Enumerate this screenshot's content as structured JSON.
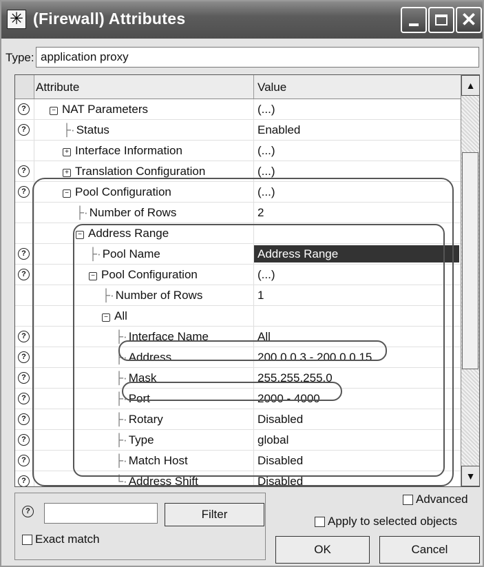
{
  "window": {
    "title": "(Firewall) Attributes",
    "title_icon": "star-icon",
    "controls": [
      "minimize-icon",
      "maximize-icon",
      "close-icon"
    ]
  },
  "type_field": {
    "label": "Type:",
    "value": "application proxy"
  },
  "grid": {
    "columns": {
      "attribute": "Attribute",
      "value": "Value"
    },
    "rows": [
      {
        "help": true,
        "indent": 1,
        "toggle": "minus",
        "name": "NAT Parameters",
        "value": "(...)"
      },
      {
        "help": true,
        "indent": 2,
        "toggle": "leaf",
        "name": "Status",
        "value": "Enabled"
      },
      {
        "help": false,
        "indent": 2,
        "toggle": "plus",
        "name": "Interface Information",
        "value": "(...)"
      },
      {
        "help": true,
        "indent": 2,
        "toggle": "plus",
        "name": "Translation Configuration",
        "value": "(...)"
      },
      {
        "help": true,
        "indent": 2,
        "toggle": "minus",
        "name": "Pool Configuration",
        "value": "(...)"
      },
      {
        "help": false,
        "indent": 3,
        "toggle": "leaf",
        "name": "Number of Rows",
        "value": "2"
      },
      {
        "help": false,
        "indent": 3,
        "toggle": "minus",
        "name": "Address Range",
        "value": ""
      },
      {
        "help": true,
        "indent": 4,
        "toggle": "leaf",
        "name": "Pool Name",
        "value": "Address Range",
        "selected": true
      },
      {
        "help": true,
        "indent": 4,
        "toggle": "minus",
        "name": "Pool Configuration",
        "value": "(...)"
      },
      {
        "help": false,
        "indent": 5,
        "toggle": "leaf",
        "name": "Number of Rows",
        "value": "1"
      },
      {
        "help": false,
        "indent": 5,
        "toggle": "minus",
        "name": "All",
        "value": ""
      },
      {
        "help": true,
        "indent": 6,
        "toggle": "leaf",
        "name": "Interface Name",
        "value": "All"
      },
      {
        "help": true,
        "indent": 6,
        "toggle": "leaf",
        "name": "Address",
        "value": "200.0.0.3 - 200.0.0.15"
      },
      {
        "help": true,
        "indent": 6,
        "toggle": "leaf",
        "name": "Mask",
        "value": "255.255.255.0"
      },
      {
        "help": true,
        "indent": 6,
        "toggle": "leaf",
        "name": "Port",
        "value": "2000 - 4000"
      },
      {
        "help": true,
        "indent": 6,
        "toggle": "leaf",
        "name": "Rotary",
        "value": "Disabled"
      },
      {
        "help": true,
        "indent": 6,
        "toggle": "leaf",
        "name": "Type",
        "value": "global"
      },
      {
        "help": true,
        "indent": 6,
        "toggle": "leaf",
        "name": "Match Host",
        "value": "Disabled"
      },
      {
        "help": true,
        "indent": 6,
        "toggle": "last",
        "name": "Address Shift",
        "value": "Disabled"
      }
    ]
  },
  "filter": {
    "value": "",
    "button_label": "Filter",
    "exact_match_label": "Exact match",
    "exact_match_checked": false
  },
  "options": {
    "advanced_label": "Advanced",
    "advanced_checked": false,
    "apply_label": "Apply to selected objects",
    "apply_checked": false
  },
  "buttons": {
    "ok": "OK",
    "cancel": "Cancel"
  },
  "colors": {
    "titlebar": "#5c5c5c",
    "selection": "#333333",
    "background": "#e4e4e4"
  }
}
